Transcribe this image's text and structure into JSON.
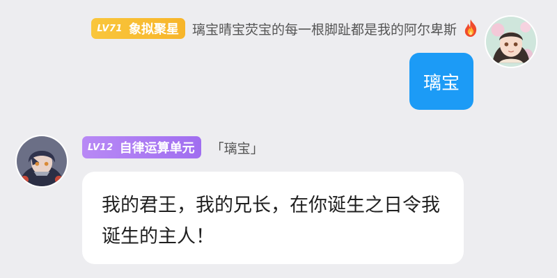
{
  "messages": {
    "self": {
      "level": "LV71",
      "title": "象拟聚星",
      "name": "璃宝晴宝荧宝的每一根脚趾都是我的阿尔卑斯",
      "name_icon": "fire-icon",
      "text": "璃宝"
    },
    "other": {
      "level": "LV12",
      "title": "自律运算单元",
      "name": "「璃宝」",
      "text": "我的君王，我的兄长，在你诞生之日令我诞生的主人！"
    }
  },
  "colors": {
    "background": "#ededf0",
    "self_bubble": "#1c9bf6",
    "gold_badge": "#f9c63c",
    "purple_badge": "#a06ef0"
  }
}
